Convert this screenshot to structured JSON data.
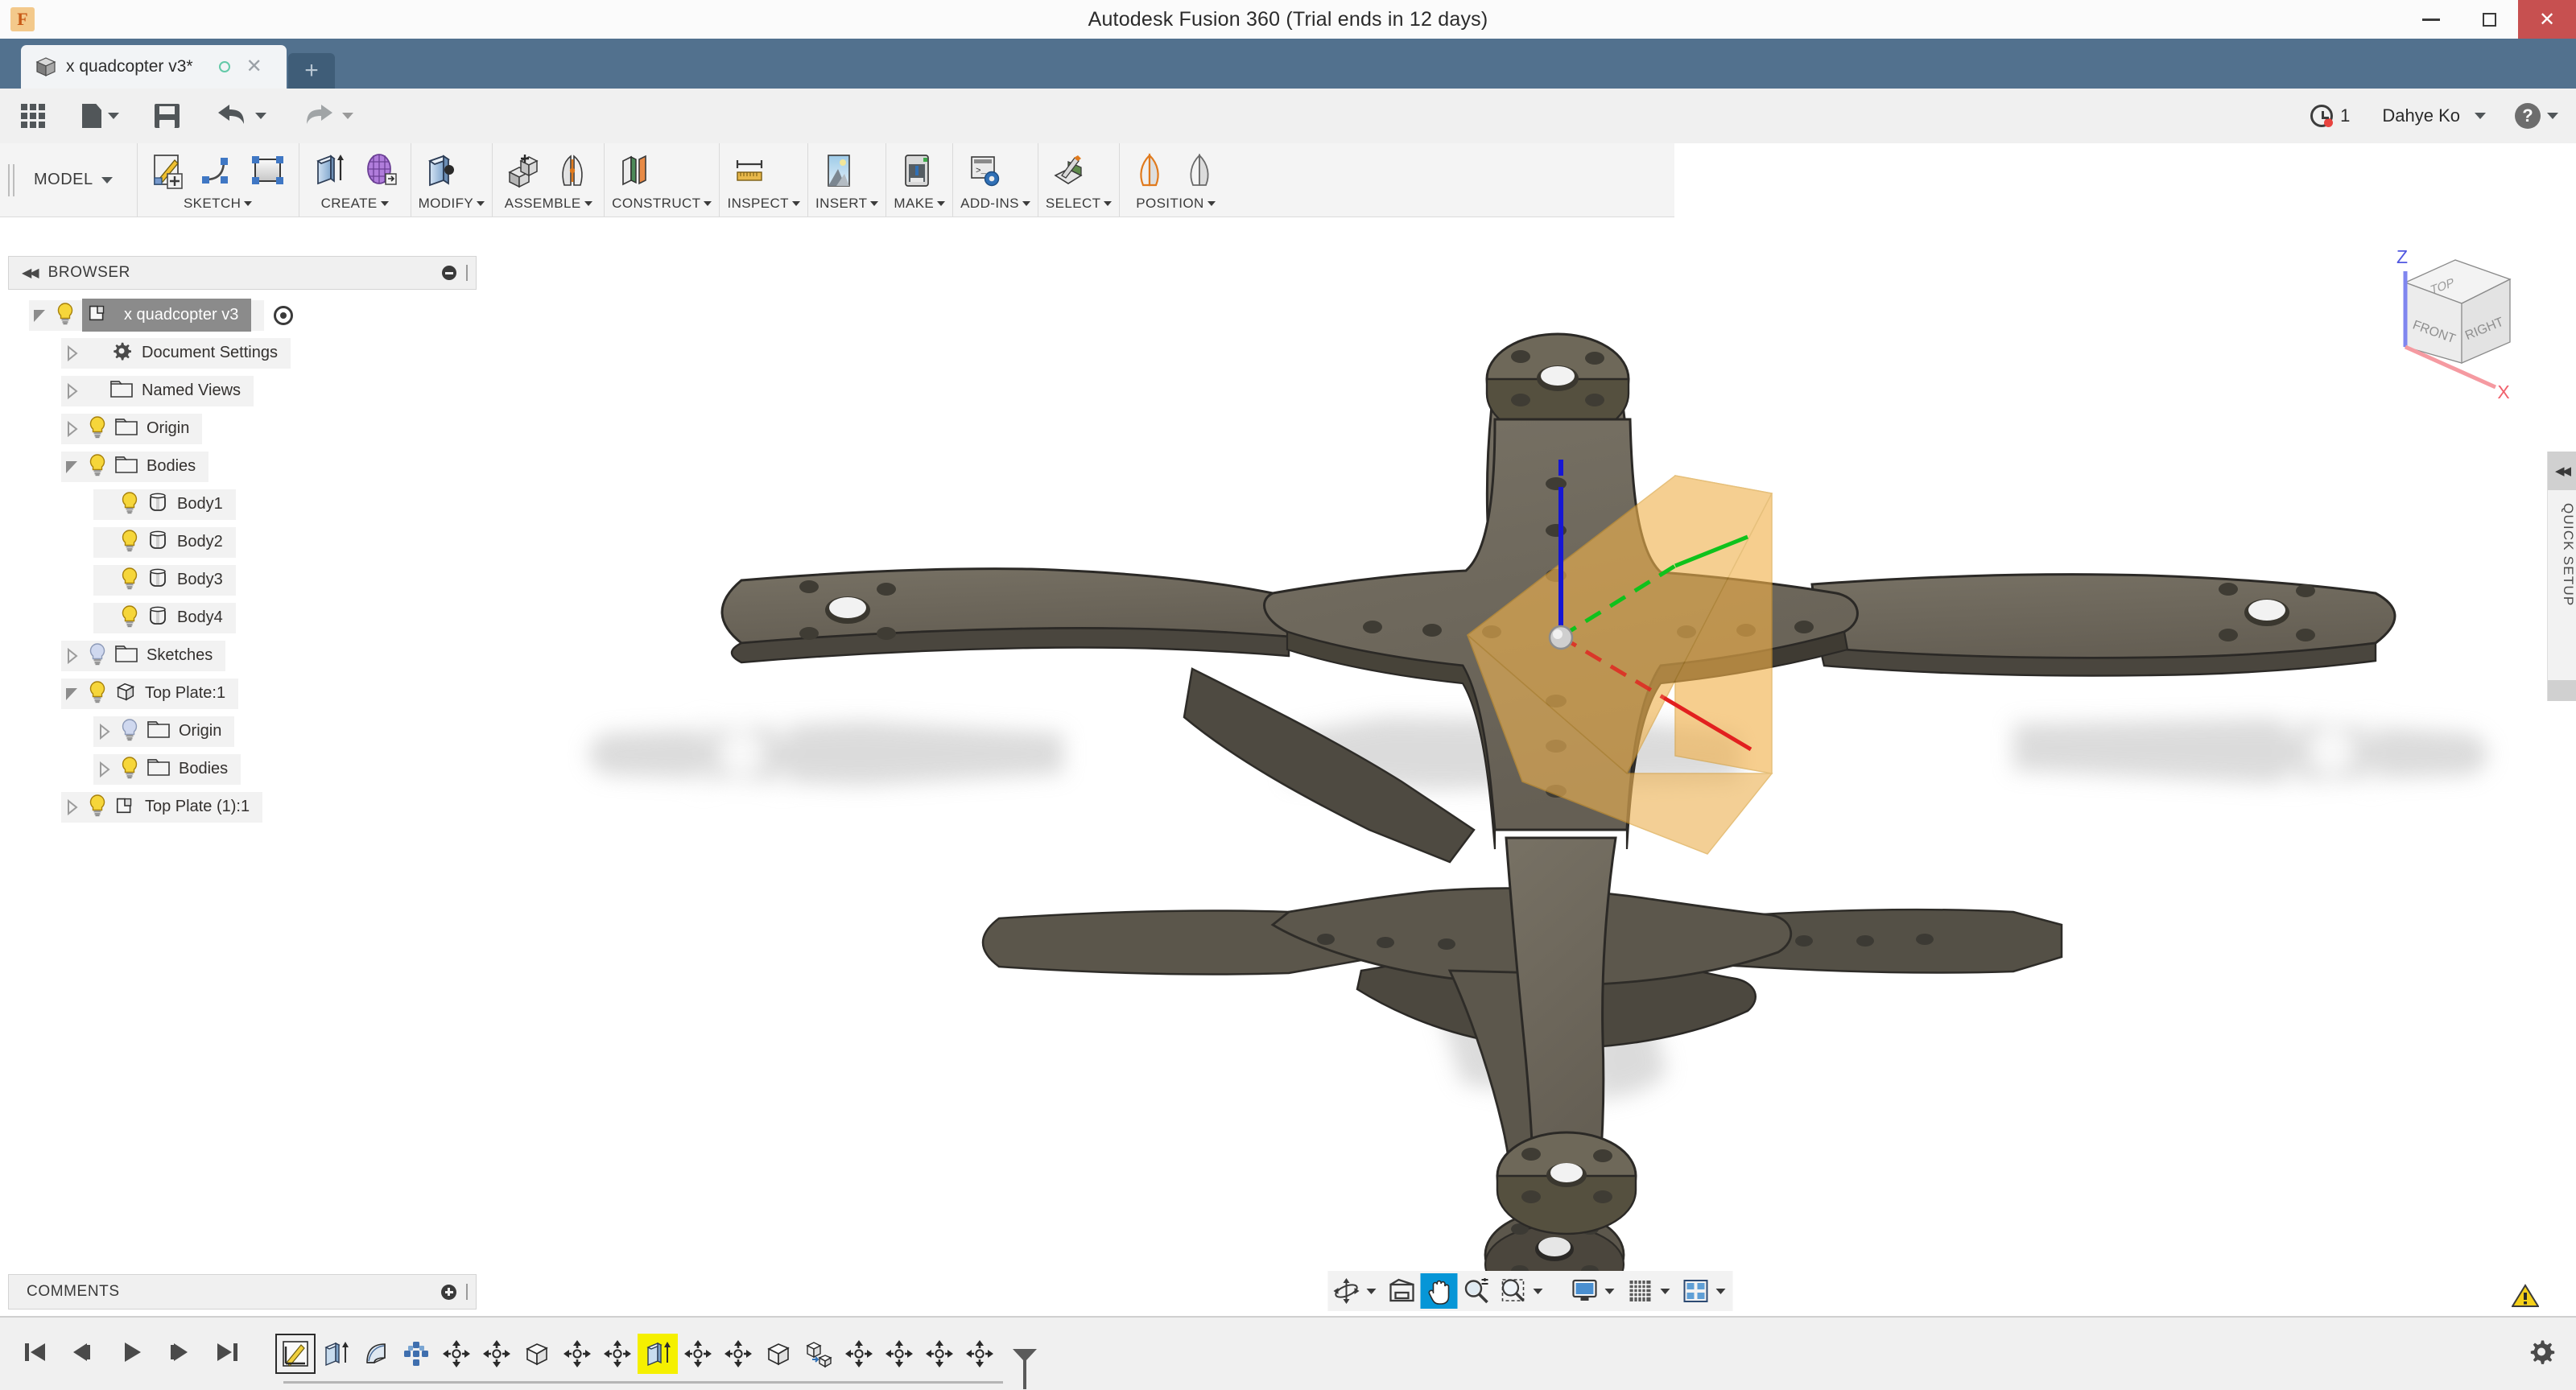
{
  "window": {
    "title": "Autodesk Fusion 360 (Trial ends in 12 days)",
    "minimize_label": "Minimize",
    "restore_label": "Restore",
    "close_label": "Close"
  },
  "tabs": {
    "documents": [
      {
        "label": "x quadcopter v3*",
        "icon": "cube-icon",
        "modified": true,
        "sync_state": "synced"
      }
    ],
    "new_tab_label": "+"
  },
  "quick_access": {
    "items": [
      {
        "name": "show-data-panel",
        "icon": "grid-icon",
        "label": "Show Data Panel"
      },
      {
        "name": "file-menu",
        "icon": "file-icon",
        "label": "File"
      },
      {
        "name": "save",
        "icon": "save-icon",
        "label": "Save"
      },
      {
        "name": "undo",
        "icon": "undo-icon",
        "label": "Undo",
        "enabled": true
      },
      {
        "name": "redo",
        "icon": "redo-icon",
        "label": "Redo",
        "enabled": false
      }
    ],
    "trial_count": "1",
    "user_name": "Dahye Ko",
    "help_label": "?"
  },
  "ribbon": {
    "workspace": "MODEL",
    "groups": [
      {
        "label": "SKETCH",
        "icons": [
          "create-sketch-icon",
          "spline-icon",
          "rectangle-icon"
        ]
      },
      {
        "label": "CREATE",
        "icons": [
          "extrude-icon",
          "form-icon"
        ]
      },
      {
        "label": "MODIFY",
        "icons": [
          "press-pull-icon"
        ]
      },
      {
        "label": "ASSEMBLE",
        "icons": [
          "new-component-icon",
          "joint-icon"
        ]
      },
      {
        "label": "CONSTRUCT",
        "icons": [
          "offset-plane-icon"
        ]
      },
      {
        "label": "INSPECT",
        "icons": [
          "measure-icon"
        ]
      },
      {
        "label": "INSERT",
        "icons": [
          "insert-image-icon"
        ]
      },
      {
        "label": "MAKE",
        "icons": [
          "3d-print-icon"
        ]
      },
      {
        "label": "ADD-INS",
        "icons": [
          "scripts-addins-icon"
        ]
      },
      {
        "label": "SELECT",
        "icons": [
          "select-paint-icon"
        ]
      },
      {
        "label": "POSITION",
        "icons": [
          "position-active-icon",
          "position-icon"
        ]
      }
    ]
  },
  "browser": {
    "title": "BROWSER",
    "collapse_label": "Collapse",
    "tree": [
      {
        "label": "x quadcopter v3",
        "depth": 0,
        "expander": "open",
        "bulb": "on",
        "icon": "component-icon",
        "selected": true,
        "has_target_radio": true
      },
      {
        "label": "Document Settings",
        "depth": 1,
        "expander": "closed",
        "bulb": "none",
        "icon": "gear-icon"
      },
      {
        "label": "Named Views",
        "depth": 1,
        "expander": "closed",
        "bulb": "none",
        "icon": "folder-icon"
      },
      {
        "label": "Origin",
        "depth": 1,
        "expander": "closed",
        "bulb": "on",
        "icon": "folder-icon"
      },
      {
        "label": "Bodies",
        "depth": 1,
        "expander": "open",
        "bulb": "on",
        "icon": "folder-icon"
      },
      {
        "label": "Body1",
        "depth": 2,
        "expander": "none",
        "bulb": "on",
        "icon": "body-icon"
      },
      {
        "label": "Body2",
        "depth": 2,
        "expander": "none",
        "bulb": "on",
        "icon": "body-icon"
      },
      {
        "label": "Body3",
        "depth": 2,
        "expander": "none",
        "bulb": "on",
        "icon": "body-icon"
      },
      {
        "label": "Body4",
        "depth": 2,
        "expander": "none",
        "bulb": "on",
        "icon": "body-icon"
      },
      {
        "label": "Sketches",
        "depth": 1,
        "expander": "closed",
        "bulb": "off",
        "icon": "folder-icon"
      },
      {
        "label": "Top Plate:1",
        "depth": 1,
        "expander": "open",
        "bulb": "on",
        "icon": "solid-cube-icon"
      },
      {
        "label": "Origin",
        "depth": 2,
        "expander": "closed",
        "bulb": "off",
        "icon": "folder-icon"
      },
      {
        "label": "Bodies",
        "depth": 2,
        "expander": "closed",
        "bulb": "on",
        "icon": "folder-icon"
      },
      {
        "label": "Top Plate (1):1",
        "depth": 1,
        "expander": "closed",
        "bulb": "on",
        "icon": "component-icon"
      }
    ]
  },
  "comments": {
    "title": "COMMENTS",
    "add_label": "Add comment"
  },
  "viewcube": {
    "top_face": "TOP",
    "front_face": "FRONT",
    "right_face": "RIGHT",
    "axis_z": "Z",
    "axis_x": "X",
    "axis_z_color": "#2f3ae0",
    "axis_x_color": "#f06a74"
  },
  "quick_setup": {
    "label": "QUICK SETUP",
    "collapse_label": "Collapse"
  },
  "navigation_bar": {
    "items": [
      {
        "name": "orbit-icon",
        "label": "Orbit",
        "has_caret": true,
        "active": false
      },
      {
        "name": "look-at-icon",
        "label": "Look At",
        "has_caret": false,
        "active": false
      },
      {
        "name": "pan-icon",
        "label": "Pan",
        "has_caret": false,
        "active": true
      },
      {
        "name": "zoom-icon",
        "label": "Zoom",
        "has_caret": false,
        "active": false
      },
      {
        "name": "fit-icon",
        "label": "Fit",
        "has_caret": true,
        "active": false
      },
      {
        "name": "display-settings-icon",
        "label": "Display Settings",
        "has_caret": true,
        "active": false
      },
      {
        "name": "grid-snaps-icon",
        "label": "Grid and Snaps",
        "has_caret": true,
        "active": false
      },
      {
        "name": "viewports-icon",
        "label": "Viewports",
        "has_caret": true,
        "active": false
      }
    ]
  },
  "status": {
    "warning_label": "Warnings",
    "settings_label": "Settings"
  },
  "timeline": {
    "playback": [
      {
        "name": "go-to-beginning-icon",
        "label": "Go to Beginning"
      },
      {
        "name": "step-back-icon",
        "label": "Step Back"
      },
      {
        "name": "play-icon",
        "label": "Play Playback"
      },
      {
        "name": "step-forward-icon",
        "label": "Step Forward"
      },
      {
        "name": "go-to-end-icon",
        "label": "Go to End"
      }
    ],
    "features": [
      {
        "name": "sketch-feature",
        "icon": "sketch-icon",
        "highlighted": false,
        "boxed": true
      },
      {
        "name": "extrude-feature",
        "icon": "extrude-icon",
        "highlighted": false,
        "boxed": false
      },
      {
        "name": "fillet-feature",
        "icon": "fillet-icon",
        "highlighted": false,
        "boxed": false
      },
      {
        "name": "pattern-feature",
        "icon": "pattern-icon",
        "highlighted": false,
        "boxed": false
      },
      {
        "name": "move-feature-1",
        "icon": "move-icon",
        "highlighted": false,
        "boxed": false
      },
      {
        "name": "move-feature-2",
        "icon": "move-icon",
        "highlighted": false,
        "boxed": false
      },
      {
        "name": "box-feature",
        "icon": "cube-icon",
        "highlighted": false,
        "boxed": false
      },
      {
        "name": "move-feature-3",
        "icon": "move-icon",
        "highlighted": false,
        "boxed": false
      },
      {
        "name": "move-feature-4",
        "icon": "move-icon",
        "highlighted": false,
        "boxed": false
      },
      {
        "name": "extrude-feature-highlighted",
        "icon": "extrude-icon",
        "highlighted": true,
        "boxed": false
      },
      {
        "name": "move-feature-5",
        "icon": "move-icon",
        "highlighted": false,
        "boxed": false
      },
      {
        "name": "move-feature-6",
        "icon": "move-icon",
        "highlighted": false,
        "boxed": false
      },
      {
        "name": "box-feature-2",
        "icon": "cube-icon",
        "highlighted": false,
        "boxed": false
      },
      {
        "name": "copy-paste-feature",
        "icon": "copy-paste-icon",
        "highlighted": false,
        "boxed": false
      },
      {
        "name": "move-feature-7",
        "icon": "move-icon",
        "highlighted": false,
        "boxed": false
      },
      {
        "name": "move-feature-8",
        "icon": "move-icon",
        "highlighted": false,
        "boxed": false
      },
      {
        "name": "move-feature-9",
        "icon": "move-icon",
        "highlighted": false,
        "boxed": false
      },
      {
        "name": "move-feature-10",
        "icon": "move-icon",
        "highlighted": false,
        "boxed": false
      }
    ],
    "marker_label": "Timeline Marker",
    "settings_label": "Timeline Settings"
  },
  "model": {
    "name": "x quadcopter frame",
    "body_color": "#6e685c",
    "body_shade_dark": "#4a4640",
    "shadow_color": "#c9c9c9",
    "origin_plane_color": "#f0b851",
    "axis_z_color": "#1414d2",
    "axis_y_color": "#0bbe1c",
    "axis_x_color": "#e01414",
    "origin_point_color": "#b8b8b8"
  }
}
